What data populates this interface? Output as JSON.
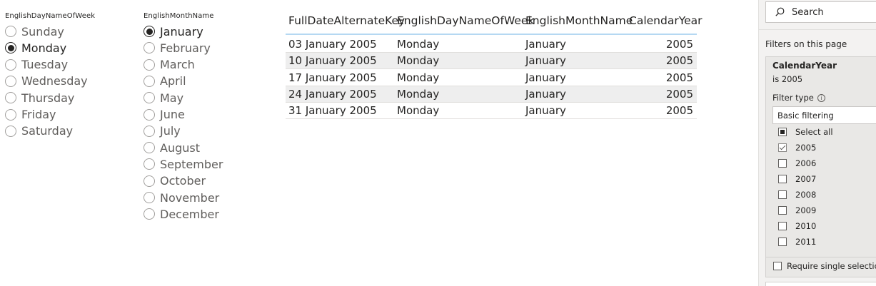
{
  "day_slicer": {
    "title": "EnglishDayNameOfWeek",
    "options": [
      "Sunday",
      "Monday",
      "Tuesday",
      "Wednesday",
      "Thursday",
      "Friday",
      "Saturday"
    ],
    "selected": "Monday"
  },
  "month_slicer": {
    "title": "EnglishMonthName",
    "options": [
      "January",
      "February",
      "March",
      "April",
      "May",
      "June",
      "July",
      "August",
      "September",
      "October",
      "November",
      "December"
    ],
    "selected": "January"
  },
  "table": {
    "columns": [
      "FullDateAlternateKey",
      "EnglishDayNameOfWeek",
      "EnglishMonthName",
      "CalendarYear"
    ],
    "rows": [
      [
        "03 January 2005",
        "Monday",
        "January",
        "2005"
      ],
      [
        "10 January 2005",
        "Monday",
        "January",
        "2005"
      ],
      [
        "17 January 2005",
        "Monday",
        "January",
        "2005"
      ],
      [
        "24 January 2005",
        "Monday",
        "January",
        "2005"
      ],
      [
        "31 January 2005",
        "Monday",
        "January",
        "2005"
      ]
    ]
  },
  "filter_pane": {
    "search_label": "Search",
    "heading": "Filters on this page",
    "card": {
      "field": "CalendarYear",
      "summary": "is 2005",
      "filter_type_label": "Filter type",
      "filter_type_value": "Basic filtering",
      "select_all_label": "Select all",
      "items": [
        {
          "label": "2005",
          "checked": true
        },
        {
          "label": "2006",
          "checked": false
        },
        {
          "label": "2007",
          "checked": false
        },
        {
          "label": "2008",
          "checked": false
        },
        {
          "label": "2009",
          "checked": false
        },
        {
          "label": "2010",
          "checked": false
        },
        {
          "label": "2011",
          "checked": false
        }
      ],
      "require_single_label": "Require single selection"
    }
  },
  "icons": {
    "search": "search-icon",
    "info": "info-icon"
  }
}
